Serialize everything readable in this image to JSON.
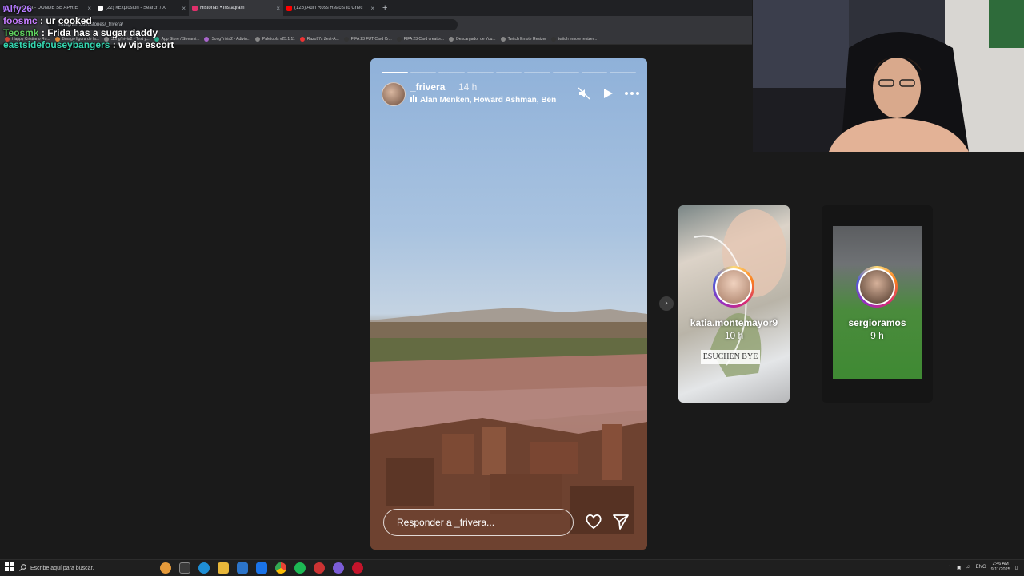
{
  "browser": {
    "tabs": [
      {
        "label": "(25) Maga - DONDE SE APRIE",
        "color": "#a970ff",
        "active": false
      },
      {
        "label": "(22) #Explosión - Search / X",
        "color": "#ffffff",
        "active": false
      },
      {
        "label": "Historias • Instagram",
        "color": "#e1306c",
        "active": true
      },
      {
        "label": "(125) Adin Ross Reacts to Chec",
        "color": "#ff0000",
        "active": false
      }
    ],
    "address": "instagram.com/stories/_frivera/",
    "bookmarks": [
      "Happy Cristiano Ro...",
      "Burago figura de la...",
      "SongTrivia2 - Test y...",
      "App Store / Streami...",
      "SongTrivia2 - Adivin...",
      "Paletools v25.1.11",
      "Razo97s Zest-A...",
      "FIFA 23 FUT Card Cr...",
      "FIFA 23 Card creator...",
      "Descargador de You...",
      "Twitch Emote Resizer",
      "twitch emote resizer..."
    ]
  },
  "chat": [
    {
      "user": "Alfy26",
      "text": "",
      "color": "#b57bff"
    },
    {
      "user": "foosmc",
      "text": ": ur cooked",
      "color": "#c77dff"
    },
    {
      "user": "Teosmk",
      "text": ": Frida has a sugar daddy",
      "color": "#5fd35f"
    },
    {
      "user": "eastsidefouseybangers",
      "text": ": w vip escort",
      "color": "#35d6b0"
    }
  ],
  "story": {
    "username": "_frivera",
    "time": "14 h",
    "music": "Alan Menken, Howard Ashman, Ben",
    "reply_placeholder": "Responder a _frivera...",
    "progress": [
      1,
      0,
      0,
      0,
      0,
      0,
      0,
      0,
      0
    ]
  },
  "next_stories": [
    {
      "username": "katia.montemayor9",
      "time": "10 h",
      "sticker": "ESUCHEN BYE"
    },
    {
      "username": "sergioramos",
      "time": "9 h"
    }
  ],
  "taskbar": {
    "search_placeholder": "Escribe aquí para buscar.",
    "language": "ENG",
    "time": "2:46 AM",
    "date": "9/11/2025"
  }
}
